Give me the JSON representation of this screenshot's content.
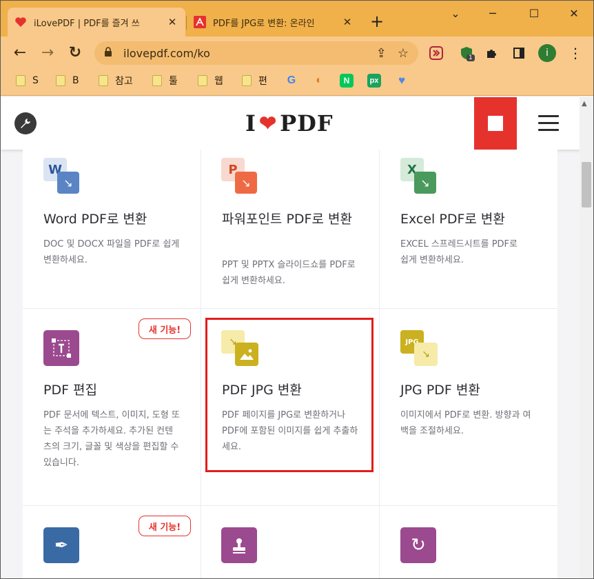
{
  "browser": {
    "tabs": [
      {
        "title": "iLovePDF | PDF를 즐겨 쓰",
        "close": "✕"
      },
      {
        "title": "PDF를 JPG로 변환: 온라인",
        "close": "✕"
      }
    ],
    "new_tab": "+",
    "window_controls": {
      "minimize": "─",
      "maximize": "☐",
      "close": "✕"
    },
    "toolbar": {
      "back": "←",
      "forward": "→",
      "reload": "↻",
      "url": "ilovepdf.com/ko",
      "share": "⇪",
      "star": "☆"
    },
    "extensions": {
      "badge": "1",
      "profile": "i",
      "menu": "⋮"
    },
    "bookmarks": [
      {
        "label": "S"
      },
      {
        "label": "B"
      },
      {
        "label": "참고"
      },
      {
        "label": "툴"
      },
      {
        "label": "웹"
      },
      {
        "label": "편"
      }
    ],
    "bookmark_icons": [
      {
        "glyph": "G",
        "color": "#4285f4"
      },
      {
        "glyph": "◐",
        "color": "#e07b2a"
      },
      {
        "glyph": "N",
        "color": "#ffffff",
        "bg": "#03c75a"
      },
      {
        "glyph": "px",
        "color": "#ffffff",
        "bg": "#1aa35c"
      },
      {
        "glyph": "♥",
        "color": "#4a8ae8"
      }
    ]
  },
  "site": {
    "logo_left": "I",
    "logo_heart": "❤",
    "logo_right": "PDF"
  },
  "tools": [
    {
      "title": "Word PDF로 변환",
      "desc": "DOC 및 DOCX 파일을 PDF로 쉽게 변환하세요.",
      "icon_letter": "W",
      "color": "#2b579a"
    },
    {
      "title": "파워포인트 PDF로 변환",
      "desc": "PPT 및 PPTX 슬라이드쇼를 PDF로 쉽게 변환하세요.",
      "icon_letter": "P",
      "color": "#d24726"
    },
    {
      "title": "Excel PDF로 변환",
      "desc": "EXCEL 스프레드시트를 PDF로 쉽게 변환하세요.",
      "icon_letter": "X",
      "color": "#217346"
    },
    {
      "title": "PDF 편집",
      "desc": "PDF 문서에 텍스트, 이미지, 도형 또는 주석을 추가하세요. 추가된 컨텐츠의 크기, 글꼴 및 색상을 편집할 수 있습니다.",
      "icon_letter": "I",
      "color": "#9b4a8f",
      "badge": "새 기능!"
    },
    {
      "title": "PDF JPG 변환",
      "desc": "PDF 페이지를 JPG로 변환하거나 PDF에 포함된 이미지를 쉽게 추출하세요.",
      "icon_letter": "▲",
      "color": "#cbb020"
    },
    {
      "title": "JPG PDF 변환",
      "desc": "이미지에서 PDF로 변환. 방향과 여백을 조절하세요.",
      "icon_letter": "JPG",
      "color": "#cbb020"
    },
    {
      "title": "",
      "desc": "",
      "icon_letter": "✒",
      "color": "#3a6aa4",
      "badge": "새 기능!"
    },
    {
      "title": "",
      "desc": "",
      "icon_letter": "⊥",
      "color": "#9b4a8f"
    },
    {
      "title": "",
      "desc": "",
      "icon_letter": "↻",
      "color": "#9b4a8f"
    }
  ]
}
